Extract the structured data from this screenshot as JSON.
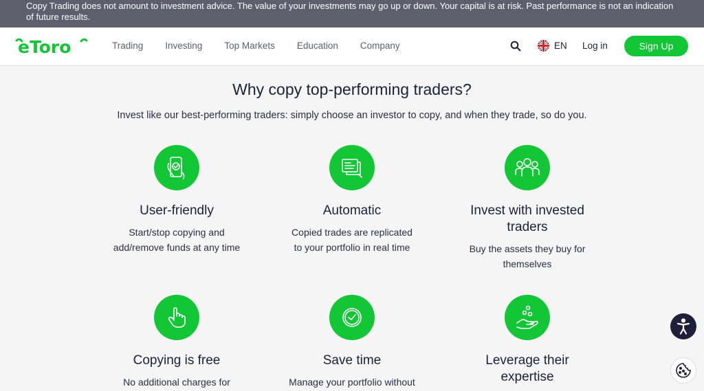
{
  "banner": {
    "text": "Copy Trading does not amount to investment advice. The value of your investments may go up or down. Your capital is at risk. Past performance is not an indication of future results."
  },
  "nav": {
    "logo": "eToro",
    "links": [
      "Trading",
      "Investing",
      "Top Markets",
      "Education",
      "Company"
    ],
    "lang": "EN",
    "login": "Log in",
    "signup": "Sign Up"
  },
  "main": {
    "title": "Why copy top-performing traders?",
    "subtitle": "Invest like our best-performing traders: simply choose an investor to copy, and when they trade, so do you.",
    "features": [
      {
        "icon": "phone-hand-icon",
        "title": "User-friendly",
        "desc": "Start/stop copying and add/remove funds at any time"
      },
      {
        "icon": "screens-icon",
        "title": "Automatic",
        "desc": "Copied trades are replicated to your portfolio in real time"
      },
      {
        "icon": "people-icon",
        "title": "Invest with invested traders",
        "desc": "Buy the assets they buy for themselves"
      },
      {
        "icon": "pointing-hand-icon",
        "title": "Copying is free",
        "desc": "No additional charges for"
      },
      {
        "icon": "clock-icon",
        "title": "Save time",
        "desc": "Manage your portfolio without"
      },
      {
        "icon": "hand-coins-icon",
        "title": "Leverage their expertise",
        "desc": ""
      }
    ]
  },
  "colors": {
    "brand": "#13c636",
    "banner": "#5e5f6d",
    "text": "#1f1f3a"
  }
}
